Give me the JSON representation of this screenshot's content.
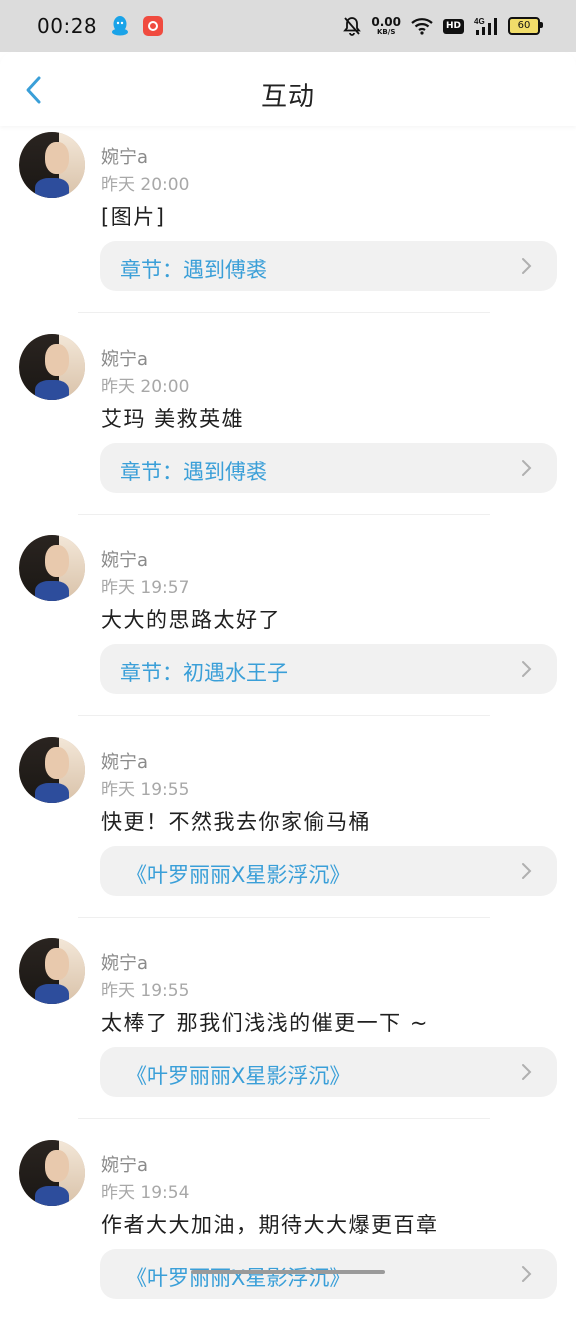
{
  "status_bar": {
    "time": "00:28",
    "speed_value": "0.00",
    "speed_unit": "KB/S",
    "hd": "HD",
    "network": "4G",
    "battery": "60",
    "icons": [
      "qq-icon",
      "app-badge-icon",
      "mute-bell-icon",
      "wifi-icon",
      "signal-icon",
      "battery-icon"
    ]
  },
  "header": {
    "title": "互动",
    "back_icon": "chevron-left-icon"
  },
  "colors": {
    "accent": "#3a9fd8",
    "link_background": "#f1f1f1",
    "meta_text": "#a8a8a8"
  },
  "feed": [
    {
      "username": "婉宁a",
      "time": "昨天 20:00",
      "comment": "[图片]",
      "link": "章节：遇到傅裘"
    },
    {
      "username": "婉宁a",
      "time": "昨天 20:00",
      "comment": "艾玛 美救英雄",
      "link": "章节：遇到傅裘"
    },
    {
      "username": "婉宁a",
      "time": "昨天 19:57",
      "comment": "大大的思路太好了",
      "link": "章节：初遇水王子"
    },
    {
      "username": "婉宁a",
      "time": "昨天 19:55",
      "comment": "快更！不然我去你家偷马桶",
      "link": "《叶罗丽丽X星影浮沉》"
    },
    {
      "username": "婉宁a",
      "time": "昨天 19:55",
      "comment": "太棒了 那我们浅浅的催更一下 ~",
      "link": "《叶罗丽丽X星影浮沉》"
    },
    {
      "username": "婉宁a",
      "time": "昨天 19:54",
      "comment": "作者大大加油，期待大大爆更百章",
      "link": "《叶罗丽丽X星影浮沉》"
    }
  ]
}
